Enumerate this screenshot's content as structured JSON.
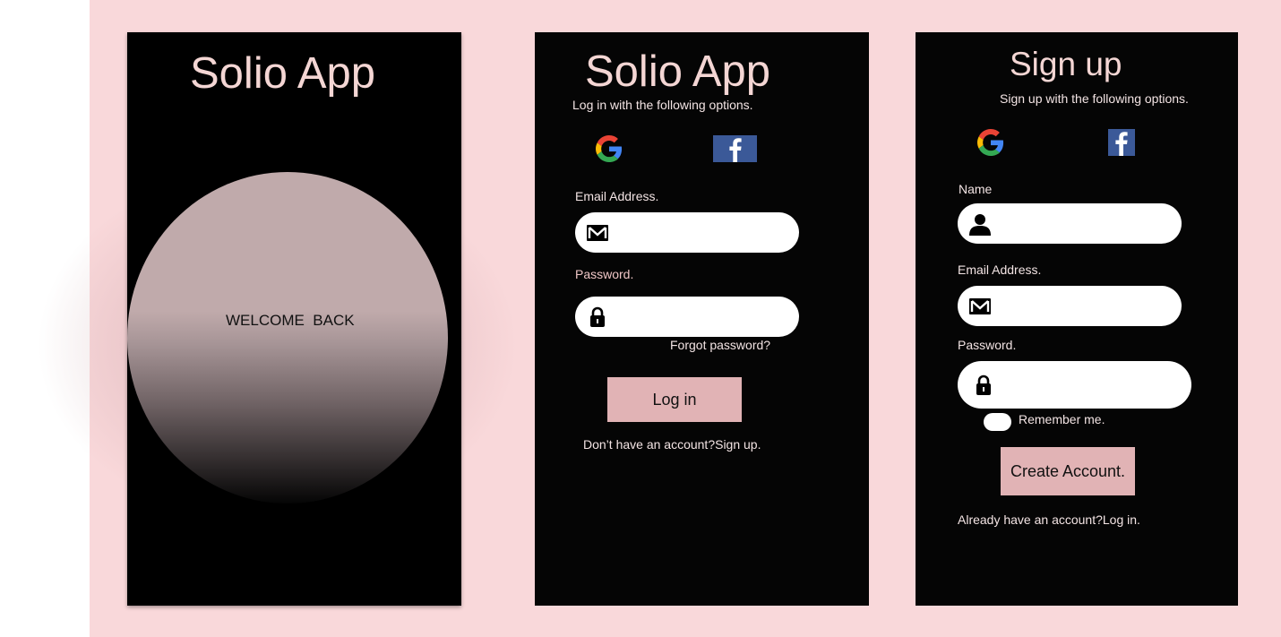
{
  "welcome_screen": {
    "title": "Solio App",
    "orb_text": "WELCOME  BACK"
  },
  "login_screen": {
    "title": "Solio App",
    "subtitle": "Log in with the following options.",
    "email_label": "Email Address.",
    "password_label": "Password.",
    "forgot_link": "Forgot password?",
    "login_button": "Log in",
    "signup_prompt": "Don’t have an account?Sign up."
  },
  "signup_screen": {
    "title": "Sign up",
    "subtitle": "Sign up with the following options.",
    "name_label": "Name",
    "email_label": "Email Address.",
    "password_label": "Password.",
    "remember_label": "Remember me.",
    "create_button": "Create Account.",
    "login_prompt": "Already have an account?Log in."
  },
  "icons": {
    "social": [
      "google-icon",
      "facebook-icon"
    ],
    "fields": [
      "user-icon",
      "mail-icon",
      "lock-icon"
    ]
  },
  "colors": {
    "canvas": "#f9d8da",
    "screen": "#050505",
    "title": "#f4d6d4",
    "button": "#e1b3b5",
    "orb": "#c0aaab",
    "facebook": "#3b5998"
  }
}
